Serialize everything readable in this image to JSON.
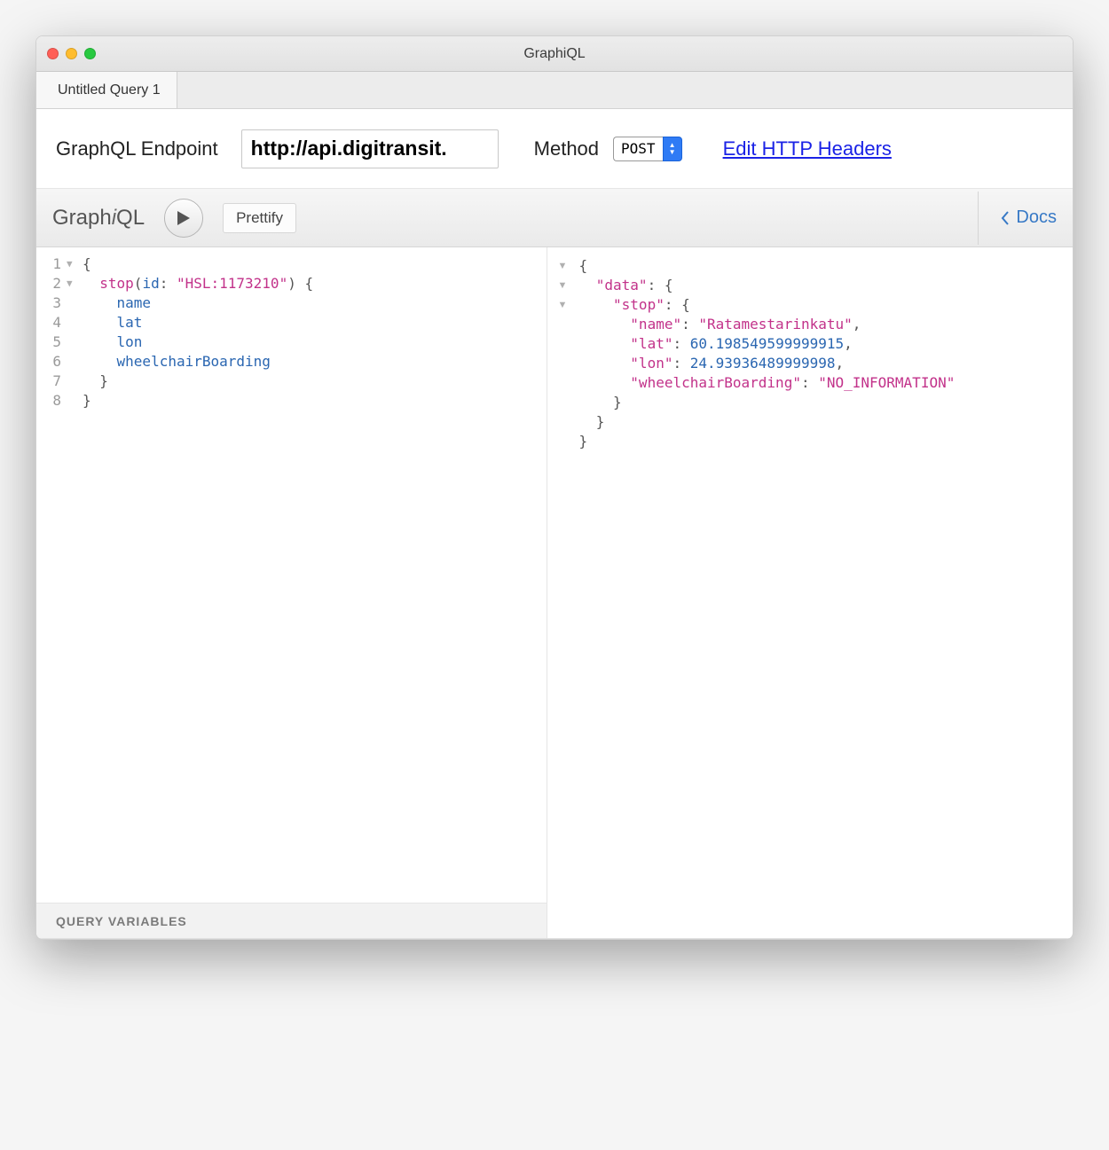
{
  "window": {
    "title": "GraphiQL"
  },
  "tab": {
    "label": "Untitled Query 1"
  },
  "config": {
    "endpoint_label": "GraphQL Endpoint",
    "endpoint_value": "http://api.digitransit.",
    "method_label": "Method",
    "method_value": "POST",
    "headers_link": "Edit HTTP Headers"
  },
  "toolbar": {
    "logo_prefix": "Graph",
    "logo_mid": "i",
    "logo_suffix": "QL",
    "prettify": "Prettify",
    "docs": "Docs"
  },
  "query": {
    "lines": [
      "1",
      "2",
      "3",
      "4",
      "5",
      "6",
      "7",
      "8"
    ],
    "l1": "{",
    "l2_kw": "stop",
    "l2_attr": "id",
    "l2_str": "\"HSL:1173210\"",
    "l3": "name",
    "l4": "lat",
    "l5": "lon",
    "l6": "wheelchairBoarding",
    "l7": "}",
    "l8": "}"
  },
  "query_vars_label": "QUERY VARIABLES",
  "result": {
    "data_key": "\"data\"",
    "stop_key": "\"stop\"",
    "name_key": "\"name\"",
    "name_val": "\"Ratamestarinkatu\"",
    "lat_key": "\"lat\"",
    "lat_val": "60.198549599999915",
    "lon_key": "\"lon\"",
    "lon_val": "24.93936489999998",
    "wb_key": "\"wheelchairBoarding\"",
    "wb_val": "\"NO_INFORMATION\""
  }
}
